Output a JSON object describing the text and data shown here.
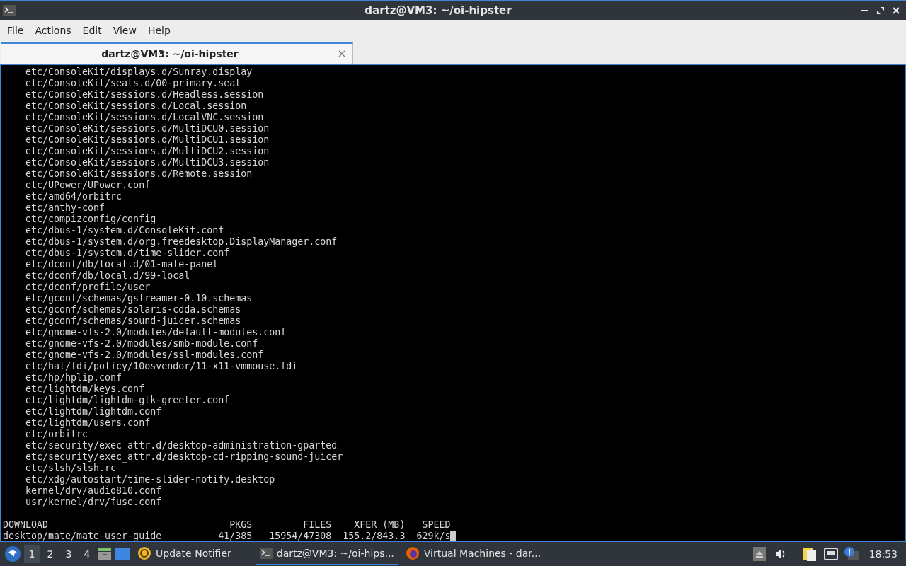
{
  "window": {
    "title": "dartz@VM3: ~/oi-hipster"
  },
  "menu": [
    "File",
    "Actions",
    "Edit",
    "View",
    "Help"
  ],
  "tabs": [
    {
      "label": "dartz@VM3: ~/oi-hipster",
      "selected": true
    }
  ],
  "terminal": {
    "lines": [
      "    etc/ConsoleKit/displays.d/Sunray.display",
      "    etc/ConsoleKit/seats.d/00-primary.seat",
      "    etc/ConsoleKit/sessions.d/Headless.session",
      "    etc/ConsoleKit/sessions.d/Local.session",
      "    etc/ConsoleKit/sessions.d/LocalVNC.session",
      "    etc/ConsoleKit/sessions.d/MultiDCU0.session",
      "    etc/ConsoleKit/sessions.d/MultiDCU1.session",
      "    etc/ConsoleKit/sessions.d/MultiDCU2.session",
      "    etc/ConsoleKit/sessions.d/MultiDCU3.session",
      "    etc/ConsoleKit/sessions.d/Remote.session",
      "    etc/UPower/UPower.conf",
      "    etc/amd64/orbitrc",
      "    etc/anthy-conf",
      "    etc/compizconfig/config",
      "    etc/dbus-1/system.d/ConsoleKit.conf",
      "    etc/dbus-1/system.d/org.freedesktop.DisplayManager.conf",
      "    etc/dbus-1/system.d/time-slider.conf",
      "    etc/dconf/db/local.d/01-mate-panel",
      "    etc/dconf/db/local.d/99-local",
      "    etc/dconf/profile/user",
      "    etc/gconf/schemas/gstreamer-0.10.schemas",
      "    etc/gconf/schemas/solaris-cdda.schemas",
      "    etc/gconf/schemas/sound-juicer.schemas",
      "    etc/gnome-vfs-2.0/modules/default-modules.conf",
      "    etc/gnome-vfs-2.0/modules/smb-module.conf",
      "    etc/gnome-vfs-2.0/modules/ssl-modules.conf",
      "    etc/hal/fdi/policy/10osvendor/11-x11-vmmouse.fdi",
      "    etc/hp/hplip.conf",
      "    etc/lightdm/keys.conf",
      "    etc/lightdm/lightdm-gtk-greeter.conf",
      "    etc/lightdm/lightdm.conf",
      "    etc/lightdm/users.conf",
      "    etc/orbitrc",
      "    etc/security/exec_attr.d/desktop-administration-gparted",
      "    etc/security/exec_attr.d/desktop-cd-ripping-sound-juicer",
      "    etc/slsh/slsh.rc",
      "    etc/xdg/autostart/time-slider-notify.desktop",
      "    kernel/drv/audio810.conf",
      "    usr/kernel/drv/fuse.conf"
    ],
    "progress": [
      "DOWNLOAD                                PKGS         FILES    XFER (MB)   SPEED",
      "desktop/mate/mate-user-guide          41/385   15954/47308  155.2/843.3  629k/s"
    ]
  },
  "taskbar": {
    "workspaces": [
      {
        "label": "1",
        "selected": true
      },
      {
        "label": "2",
        "selected": false
      },
      {
        "label": "3",
        "selected": false
      },
      {
        "label": "4",
        "selected": false
      }
    ],
    "tasks": [
      {
        "label": "Update Notifier",
        "kind": "update",
        "selected": false
      },
      {
        "label": "dartz@VM3: ~/oi-hips...",
        "kind": "terminal",
        "selected": true
      },
      {
        "label": "Virtual Machines - dar...",
        "kind": "browser",
        "selected": false
      }
    ],
    "clock": "18:53"
  }
}
